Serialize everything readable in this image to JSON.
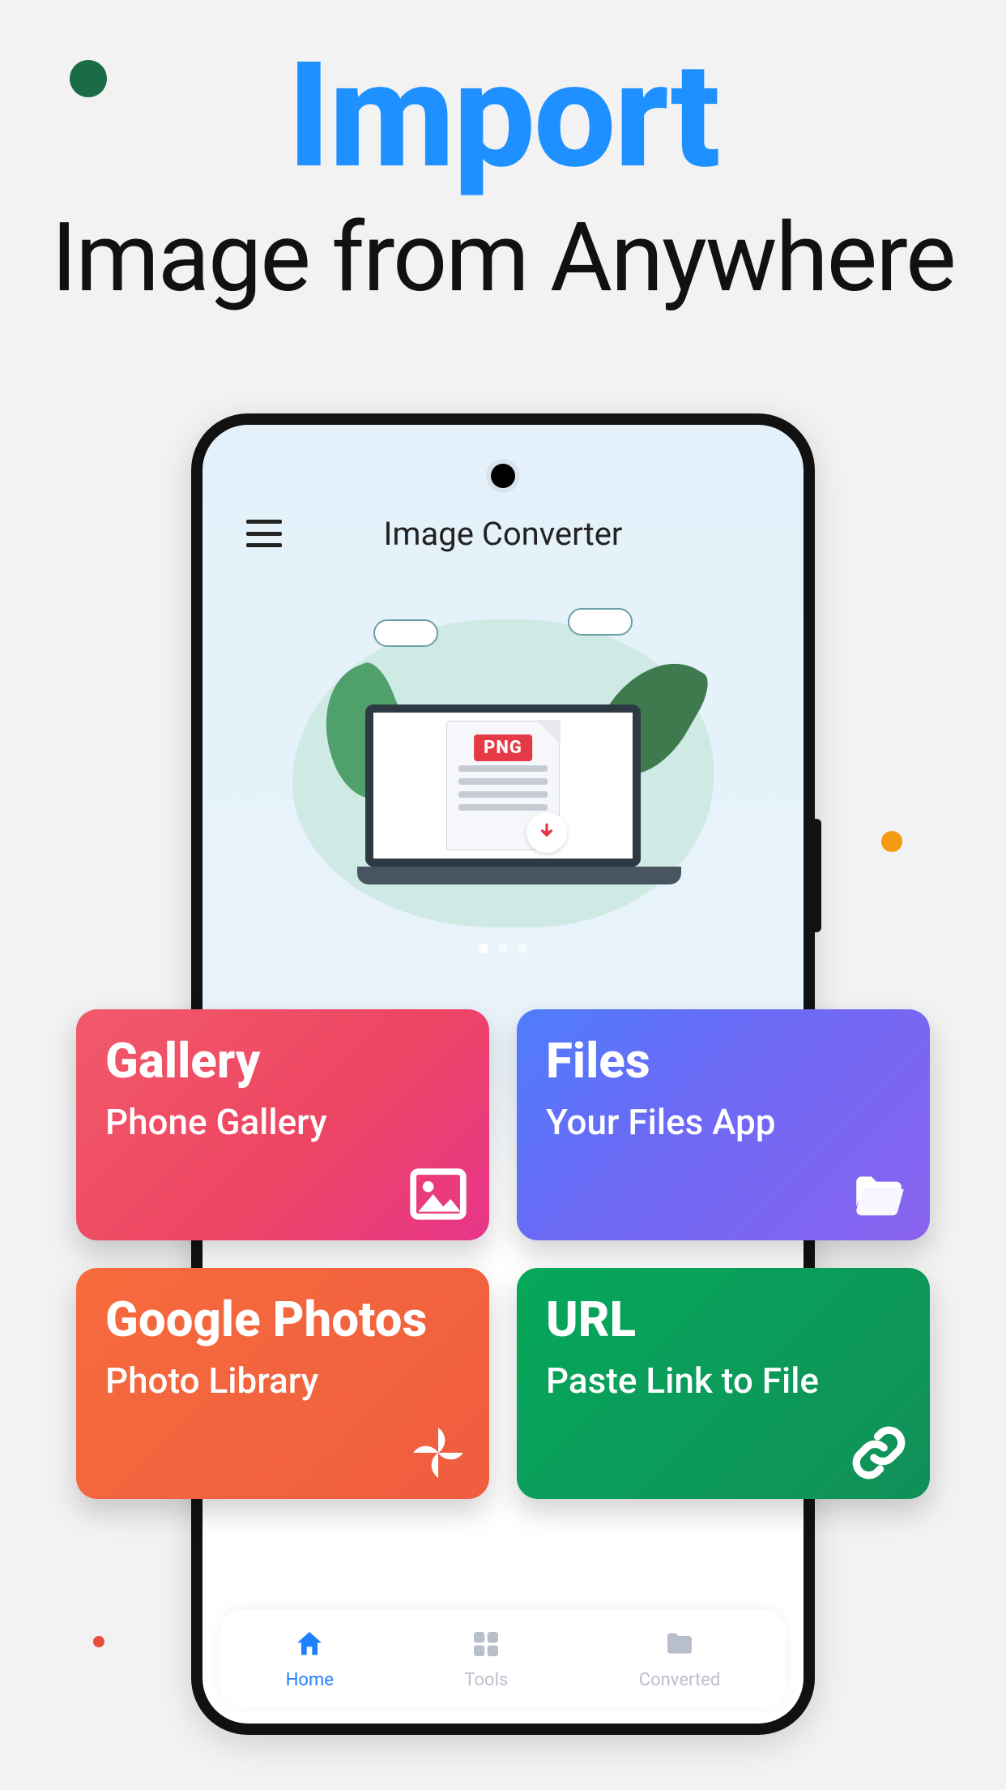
{
  "headline": {
    "title": "Import",
    "subtitle": "Image from Anywhere"
  },
  "app": {
    "title": "Image Converter",
    "hero": {
      "badge": "PNG"
    },
    "nav": [
      {
        "label": "Home",
        "active": true
      },
      {
        "label": "Tools",
        "active": false
      },
      {
        "label": "Converted",
        "active": false
      }
    ]
  },
  "cards": [
    {
      "key": "gallery",
      "title": "Gallery",
      "desc": "Phone Gallery",
      "icon": "image-icon"
    },
    {
      "key": "files",
      "title": "Files",
      "desc": "Your Files App",
      "icon": "folder-icon"
    },
    {
      "key": "gphotos",
      "title": "Google Photos",
      "desc": "Photo Library",
      "icon": "pinwheel-icon"
    },
    {
      "key": "url",
      "title": "URL",
      "desc": "Paste Link to File",
      "icon": "link-icon"
    }
  ]
}
